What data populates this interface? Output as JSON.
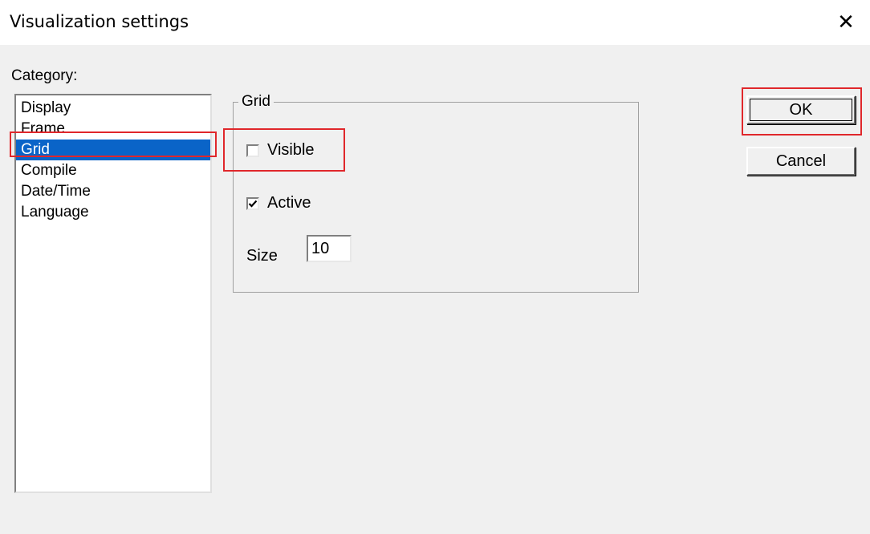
{
  "window": {
    "title": "Visualization settings",
    "close_glyph": "✕"
  },
  "category": {
    "label": "Category:",
    "items": [
      "Display",
      "Frame",
      "Grid",
      "Compile",
      "Date/Time",
      "Language"
    ],
    "selected": "Grid"
  },
  "grid_group": {
    "title": "Grid",
    "visible": {
      "label": "Visible",
      "checked": false
    },
    "active": {
      "label": "Active",
      "checked": true
    },
    "size": {
      "label": "Size",
      "value": "10"
    }
  },
  "buttons": {
    "ok_label": "OK",
    "cancel_label": "Cancel"
  },
  "colors": {
    "selection": "#0a64c8",
    "highlight": "#e0272b",
    "background": "#f0f0f0"
  }
}
